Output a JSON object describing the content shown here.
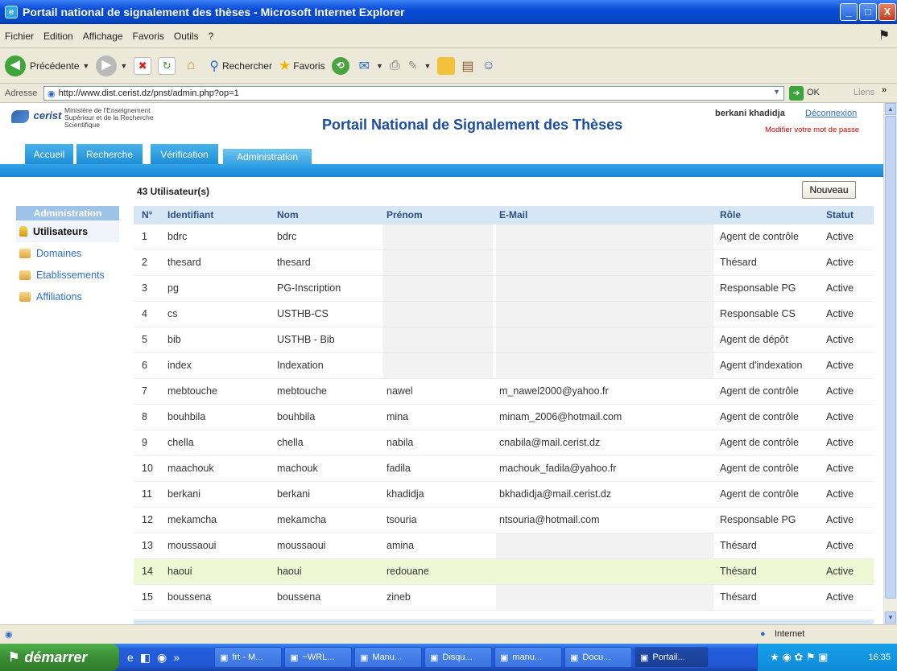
{
  "window": {
    "title": "Portail national de signalement des thèses - Microsoft Internet Explorer",
    "btn_min": "_",
    "btn_max": "□",
    "btn_close": "X"
  },
  "menu": [
    "Fichier",
    "Edition",
    "Affichage",
    "Favoris",
    "Outils",
    "?"
  ],
  "toolbar": {
    "back": "Précédente",
    "search": "Rechercher",
    "favorites": "Favoris"
  },
  "address": {
    "label": "Adresse",
    "url": "http://www.dist.cerist.dz/pnst/admin.php?op=1",
    "go": "OK",
    "links": "Liens"
  },
  "page": {
    "logo": "cerist",
    "ministry": [
      "Ministère de l'Enseignement",
      "Supérieur et de la Recherche",
      "Scientifique"
    ],
    "title": "Portail National de Signalement des Thèses",
    "user": "berkani khadidja",
    "logout": "Déconnexion",
    "change_password": "Modifier votre mot de passe",
    "tabs": [
      "Accueil",
      "Recherche",
      "Vérification",
      "Administration"
    ],
    "sidebar": {
      "heading": "Administration",
      "items": [
        "Utilisateurs",
        "Domaines",
        "Etablissements",
        "Affiliations"
      ]
    },
    "count": "43 Utilisateur(s)",
    "new_button": "Nouveau",
    "columns": [
      "N°",
      "Identifiant",
      "Nom",
      "Prénom",
      "E-Mail",
      "Rôle",
      "Statut"
    ],
    "rows": [
      [
        "1",
        "bdrc",
        "bdrc",
        "",
        "",
        "Agent de contrôle",
        "Active"
      ],
      [
        "2",
        "thesard",
        "thesard",
        "",
        "",
        "Thésard",
        "Active"
      ],
      [
        "3",
        "pg",
        "PG-Inscription",
        "",
        "",
        "Responsable PG",
        "Active"
      ],
      [
        "4",
        "cs",
        "USTHB-CS",
        "",
        "",
        "Responsable CS",
        "Active"
      ],
      [
        "5",
        "bib",
        "USTHB - Bib",
        "",
        "",
        "Agent de dépôt",
        "Active"
      ],
      [
        "6",
        "index",
        "Indexation",
        "",
        "",
        "Agent d'indexation",
        "Active"
      ],
      [
        "7",
        "mebtouche",
        "mebtouche",
        "nawel",
        "m_nawel2000@yahoo.fr",
        "Agent de contrôle",
        "Active"
      ],
      [
        "8",
        "bouhbila",
        "bouhbila",
        "mina",
        "minam_2006@hotmail.com",
        "Agent de contrôle",
        "Active"
      ],
      [
        "9",
        "chella",
        "chella",
        "nabila",
        "cnabila@mail.cerist.dz",
        "Agent de contrôle",
        "Active"
      ],
      [
        "10",
        "maachouk",
        "machouk",
        "fadila",
        "machouk_fadila@yahoo.fr",
        "Agent de contrôle",
        "Active"
      ],
      [
        "11",
        "berkani",
        "berkani",
        "khadidja",
        "bkhadidja@mail.cerist.dz",
        "Agent de contrôle",
        "Active"
      ],
      [
        "12",
        "mekamcha",
        "mekamcha",
        "tsouria",
        "ntsouria@hotmail.com",
        "Responsable PG",
        "Active"
      ],
      [
        "13",
        "moussaoui",
        "moussaoui",
        "amina",
        "",
        "Thésard",
        "Active"
      ],
      [
        "14",
        "haoui",
        "haoui",
        "redouane",
        "",
        "Thésard",
        "Active"
      ],
      [
        "15",
        "boussena",
        "boussena",
        "zineb",
        "",
        "Thésard",
        "Active"
      ]
    ],
    "highlighted_row": 14
  },
  "status": {
    "zone": "Internet"
  },
  "taskbar": {
    "start": "démarrer",
    "tasks": [
      "frt - M...",
      "~WRL...",
      "Manu...",
      "Disqu...",
      "manu...",
      "Docu...",
      "Portail..."
    ],
    "active_task": "Portail...",
    "clock": "16:35"
  },
  "colors": {
    "accent": "#1e8ed6",
    "title": "#1c4ea3",
    "header_row": "#d6e6f5",
    "highlight_row": "#eef8d4",
    "link": "#2d6fc4",
    "warning": "#cc0000"
  }
}
